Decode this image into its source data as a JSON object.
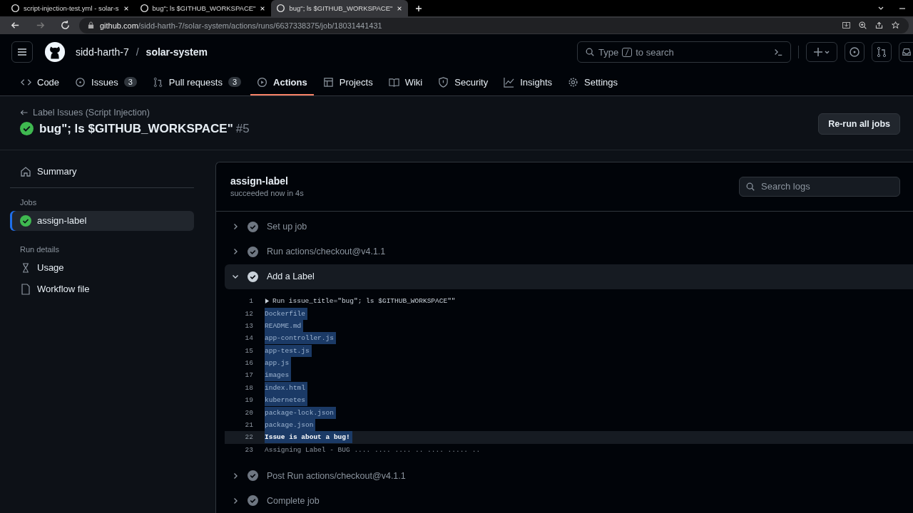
{
  "browser": {
    "tabs": [
      {
        "title": "script-injection-test.yml - solar-s",
        "selected": false
      },
      {
        "title": "bug\"; ls $GITHUB_WORKSPACE\"",
        "selected": false
      },
      {
        "title": "bug\"; ls $GITHUB_WORKSPACE\"",
        "selected": true
      }
    ],
    "url_host": "github.com",
    "url_path": "/sidd-harth-7/solar-system/actions/runs/6637338375/job/18031441431"
  },
  "header": {
    "owner": "sidd-harth-7",
    "separator": "/",
    "repo": "solar-system",
    "search_prefix": "Type",
    "search_key": "/",
    "search_suffix": "to search"
  },
  "repo_nav": [
    {
      "label": "Code",
      "selected": false
    },
    {
      "label": "Issues",
      "count": "3",
      "selected": false
    },
    {
      "label": "Pull requests",
      "count": "3",
      "selected": false
    },
    {
      "label": "Actions",
      "selected": true
    },
    {
      "label": "Projects",
      "selected": false
    },
    {
      "label": "Wiki",
      "selected": false
    },
    {
      "label": "Security",
      "selected": false
    },
    {
      "label": "Insights",
      "selected": false
    },
    {
      "label": "Settings",
      "selected": false
    }
  ],
  "run": {
    "workflow": "Label Issues (Script Injection)",
    "title": "bug\"; ls $GITHUB_WORKSPACE\"",
    "number": "#5",
    "rerun_button": "Re-run all jobs"
  },
  "sidebar": {
    "summary": "Summary",
    "jobs_heading": "Jobs",
    "jobs": [
      {
        "label": "assign-label",
        "selected": true
      }
    ],
    "details_heading": "Run details",
    "details": [
      {
        "label": "Usage"
      },
      {
        "label": "Workflow file"
      }
    ]
  },
  "job": {
    "name": "assign-label",
    "status": "succeeded now in 4s",
    "search_placeholder": "Search logs",
    "steps": [
      {
        "title": "Set up job",
        "expanded": false
      },
      {
        "title": "Run actions/checkout@v4.1.1",
        "expanded": false
      },
      {
        "title": "Add a Label",
        "expanded": true,
        "log": [
          {
            "number": "1",
            "kind": "command",
            "text": "Run issue_title=\"bug\"; ls $GITHUB_WORKSPACE\"\"",
            "selected": false
          },
          {
            "number": "12",
            "kind": "output",
            "text": "Dockerfile",
            "selected": true
          },
          {
            "number": "13",
            "kind": "output",
            "text": "README.md",
            "selected": true
          },
          {
            "number": "14",
            "kind": "output",
            "text": "app-controller.js",
            "selected": true
          },
          {
            "number": "15",
            "kind": "output",
            "text": "app-test.js",
            "selected": true
          },
          {
            "number": "16",
            "kind": "output",
            "text": "app.js",
            "selected": true
          },
          {
            "number": "17",
            "kind": "output",
            "text": "images",
            "selected": true
          },
          {
            "number": "18",
            "kind": "output",
            "text": "index.html",
            "selected": true
          },
          {
            "number": "19",
            "kind": "output",
            "text": "kubernetes",
            "selected": true
          },
          {
            "number": "20",
            "kind": "output",
            "text": "package-lock.json",
            "selected": true
          },
          {
            "number": "21",
            "kind": "output",
            "text": "package.json",
            "selected": true
          },
          {
            "number": "22",
            "kind": "echo",
            "text": "Issue is about a bug!",
            "selected": true
          },
          {
            "number": "23",
            "kind": "output",
            "text": "Assigning Label - BUG .... .... .... .. .... ..... ..",
            "selected": false
          }
        ]
      },
      {
        "title": "Post Run actions/checkout@v4.1.1",
        "expanded": false
      },
      {
        "title": "Complete job",
        "expanded": false
      }
    ]
  }
}
